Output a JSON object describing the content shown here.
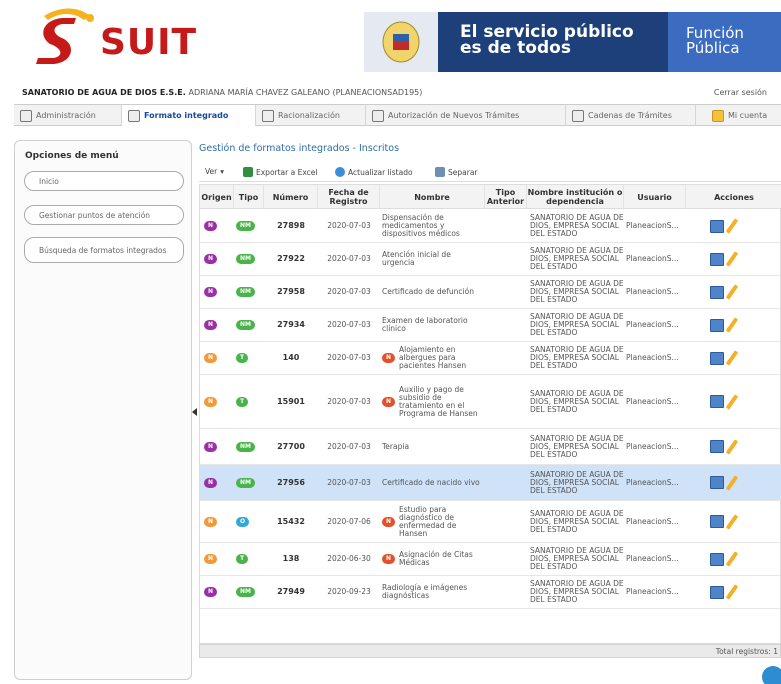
{
  "header": {
    "logo_text": "SUIT",
    "banner_line1": "El servicio público",
    "banner_line2": "es de todos",
    "banner_right1": "Función",
    "banner_right2": "Pública"
  },
  "infobar": {
    "entity": "SANATORIO DE AGUA DE DIOS E.S.E.",
    "user": "ADRIANA MARÍA CHAVEZ GALEANO (PLANEACIONSAD195)",
    "logout": "Cerrar sesión"
  },
  "nav": {
    "tabs": [
      {
        "label": "Administración"
      },
      {
        "label": "Formato integrado"
      },
      {
        "label": "Racionalización"
      },
      {
        "label": "Autorización de Nuevos Trámites"
      },
      {
        "label": "Cadenas de Trámites"
      },
      {
        "label": "Mi cuenta"
      }
    ]
  },
  "sidebar": {
    "title": "Opciones de menú",
    "items": [
      {
        "label": "Inicio"
      },
      {
        "label": "Gestionar puntos de atención"
      },
      {
        "label": "Búsqueda de formatos integrados"
      }
    ]
  },
  "main": {
    "title": "Gestión de formatos integrados - Inscritos",
    "toolbar": {
      "ver": "Ver",
      "export": "Exportar a Excel",
      "refresh": "Actualizar listado",
      "separate": "Separar"
    },
    "columns": [
      "Origen",
      "Tipo",
      "Número",
      "Fecha de Registro",
      "Nombre",
      "Tipo Anterior",
      "Nombre institución o dependencia",
      "Usuario",
      "Acciones"
    ],
    "rows": [
      {
        "origen": "N",
        "origen_color": "#9b2fa5",
        "tipo": "NM",
        "tipo_color": "#49b44a",
        "numero": "27898",
        "fecha": "2020-07-03",
        "nombre": "Dispensación de medicamentos y dispositivos médicos",
        "badge": "",
        "inst": "SANATORIO DE AGUA DE DIOS, EMPRESA SOCIAL DEL ESTADO",
        "usuario": "PlaneacionS..."
      },
      {
        "origen": "N",
        "origen_color": "#9b2fa5",
        "tipo": "NM",
        "tipo_color": "#49b44a",
        "numero": "27922",
        "fecha": "2020-07-03",
        "nombre": "Atención inicial de urgencia",
        "badge": "",
        "inst": "SANATORIO DE AGUA DE DIOS, EMPRESA SOCIAL DEL ESTADO",
        "usuario": "PlaneacionS..."
      },
      {
        "origen": "N",
        "origen_color": "#9b2fa5",
        "tipo": "NM",
        "tipo_color": "#49b44a",
        "numero": "27958",
        "fecha": "2020-07-03",
        "nombre": "Certificado de defunción",
        "badge": "",
        "inst": "SANATORIO DE AGUA DE DIOS, EMPRESA SOCIAL DEL ESTADO",
        "usuario": "PlaneacionS..."
      },
      {
        "origen": "N",
        "origen_color": "#9b2fa5",
        "tipo": "NM",
        "tipo_color": "#49b44a",
        "numero": "27934",
        "fecha": "2020-07-03",
        "nombre": "Examen de laboratorio clínico",
        "badge": "",
        "inst": "SANATORIO DE AGUA DE DIOS, EMPRESA SOCIAL DEL ESTADO",
        "usuario": "PlaneacionS..."
      },
      {
        "origen": "N",
        "origen_color": "#f09a3a",
        "tipo": "T",
        "tipo_color": "#49b44a",
        "numero": "140",
        "fecha": "2020-07-03",
        "nombre": "Alojamiento en albergues para pacientes Hansen",
        "badge": "N",
        "inst": "SANATORIO DE AGUA DE DIOS, EMPRESA SOCIAL DEL ESTADO",
        "usuario": "PlaneacionS..."
      },
      {
        "origen": "N",
        "origen_color": "#f09a3a",
        "tipo": "T",
        "tipo_color": "#49b44a",
        "numero": "15901",
        "fecha": "2020-07-03",
        "nombre": "Auxilio y pago de subsidio de tratamiento en el Programa de Hansen",
        "badge": "N",
        "inst": "SANATORIO DE AGUA DE DIOS, EMPRESA SOCIAL DEL ESTADO",
        "usuario": "PlaneacionS..."
      },
      {
        "origen": "N",
        "origen_color": "#9b2fa5",
        "tipo": "NM",
        "tipo_color": "#49b44a",
        "numero": "27700",
        "fecha": "2020-07-03",
        "nombre": "Terapia",
        "badge": "",
        "inst": "SANATORIO DE AGUA DE DIOS, EMPRESA SOCIAL DEL ESTADO",
        "usuario": "PlaneacionS..."
      },
      {
        "origen": "N",
        "origen_color": "#9b2fa5",
        "tipo": "NM",
        "tipo_color": "#49b44a",
        "numero": "27956",
        "fecha": "2020-07-03",
        "nombre": "Certificado de nacido vivo",
        "badge": "",
        "inst": "SANATORIO DE AGUA DE DIOS, EMPRESA SOCIAL DEL ESTADO",
        "usuario": "PlaneacionS...",
        "selected": true
      },
      {
        "origen": "N",
        "origen_color": "#f09a3a",
        "tipo": "O",
        "tipo_color": "#31a8d8",
        "numero": "15432",
        "fecha": "2020-07-06",
        "nombre": "Estudio para diagnóstico de enfermedad de Hansen",
        "badge": "N",
        "inst": "SANATORIO DE AGUA DE DIOS, EMPRESA SOCIAL DEL ESTADO",
        "usuario": "PlaneacionS..."
      },
      {
        "origen": "N",
        "origen_color": "#f09a3a",
        "tipo": "T",
        "tipo_color": "#49b44a",
        "numero": "138",
        "fecha": "2020-06-30",
        "nombre": "Asignación de Citas Médicas",
        "badge": "N",
        "inst": "SANATORIO DE AGUA DE DIOS, EMPRESA SOCIAL DEL ESTADO",
        "usuario": "PlaneacionS..."
      },
      {
        "origen": "N",
        "origen_color": "#9b2fa5",
        "tipo": "NM",
        "tipo_color": "#49b44a",
        "numero": "27949",
        "fecha": "2020-09-23",
        "nombre": "Radiología e imágenes diagnósticas",
        "badge": "",
        "inst": "SANATORIO DE AGUA DE DIOS, EMPRESA SOCIAL DEL ESTADO",
        "usuario": "PlaneacionS..."
      }
    ],
    "footer_total": "Total registros: 1"
  }
}
